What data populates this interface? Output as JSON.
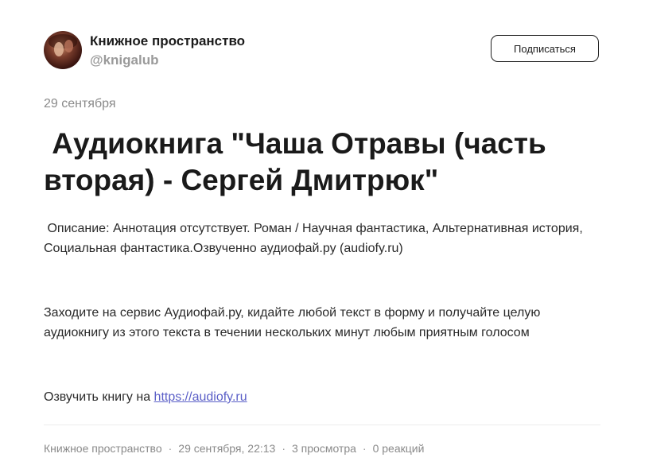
{
  "channel": {
    "name": "Книжное пространство",
    "handle": "@knigalub",
    "subscribe_label": "Подписаться"
  },
  "post": {
    "date": "29 сентября",
    "title": " Аудиокнига \"Чаша Отравы (часть вторая) - Сергей Дмитрюк\"",
    "description": " Описание: Аннотация отсутствует. Роман / Научная фантастика, Альтернативная история, Социальная фантастика.Озвученно аудиофай.ру (audiofy.ru)",
    "promo": "Заходите на сервис Аудиофай.ру, кидайте любой текст в форму и получайте целую аудиокнигу из этого текста в течении нескольких минут любым приятным голосом",
    "cta_prefix": "Озвучить книгу на ",
    "cta_link_text": "https://audiofy.ru"
  },
  "footer": {
    "channel": "Книжное пространство",
    "datetime": "29 сентября, 22:13",
    "views": "3 просмотра",
    "reactions": "0 реакций",
    "separator": "·"
  },
  "colors": {
    "link": "#5b5fc7",
    "muted": "#8a8a8a",
    "text": "#1a1a1a"
  }
}
